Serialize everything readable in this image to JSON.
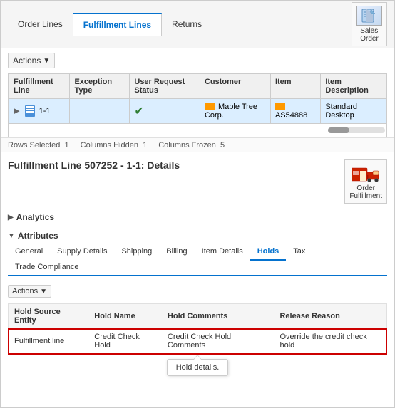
{
  "tabs": {
    "items": [
      {
        "label": "Order Lines",
        "active": false
      },
      {
        "label": "Fulfillment Lines",
        "active": true
      },
      {
        "label": "Returns",
        "active": false
      }
    ]
  },
  "salesOrderIcon": {
    "label": "Sales\nOrder"
  },
  "topToolbar": {
    "actionsLabel": "Actions"
  },
  "tableHeaders": [
    {
      "label": "Fulfillment Line"
    },
    {
      "label": "Exception Type"
    },
    {
      "label": "User Request Status"
    },
    {
      "label": "Customer"
    },
    {
      "label": "Item"
    },
    {
      "label": "Item Description"
    }
  ],
  "tableRow": {
    "id": "1-1",
    "exceptionType": "",
    "userRequestStatus": "check",
    "customer": "Maple Tree Corp.",
    "item": "AS54888",
    "itemDescription": "Standard Desktop"
  },
  "statusBar": {
    "rowsSelected": "Rows Selected",
    "rowsCount": "1",
    "columnsHidden": "Columns Hidden",
    "columnsHiddenCount": "1",
    "columnsFrozen": "Columns Frozen",
    "columnsFrozenCount": "5"
  },
  "detailsSection": {
    "title": "Fulfillment Line 507252 - 1-1: Details",
    "orderFulfillmentLabel": "Order\nFulfillment",
    "analytics": {
      "label": "Analytics",
      "collapsed": true
    },
    "attributes": {
      "label": "Attributes",
      "collapsed": false
    }
  },
  "subTabs": {
    "items": [
      {
        "label": "General",
        "active": false
      },
      {
        "label": "Supply Details",
        "active": false
      },
      {
        "label": "Shipping",
        "active": false
      },
      {
        "label": "Billing",
        "active": false
      },
      {
        "label": "Item Details",
        "active": false
      },
      {
        "label": "Holds",
        "active": true
      },
      {
        "label": "Tax",
        "active": false
      },
      {
        "label": "Trade Compliance",
        "active": false
      }
    ]
  },
  "innerToolbar": {
    "actionsLabel": "Actions"
  },
  "innerTableHeaders": [
    {
      "label": "Hold Source Entity"
    },
    {
      "label": "Hold Name"
    },
    {
      "label": "Hold Comments"
    },
    {
      "label": "Release Reason"
    }
  ],
  "innerTableRow": {
    "holdSourceEntity": "Fulfillment line",
    "holdName": "Credit Check Hold",
    "holdComments": "Credit Check Hold Comments",
    "releaseReason": "Override the credit check hold"
  },
  "tooltip": {
    "text": "Hold details."
  }
}
